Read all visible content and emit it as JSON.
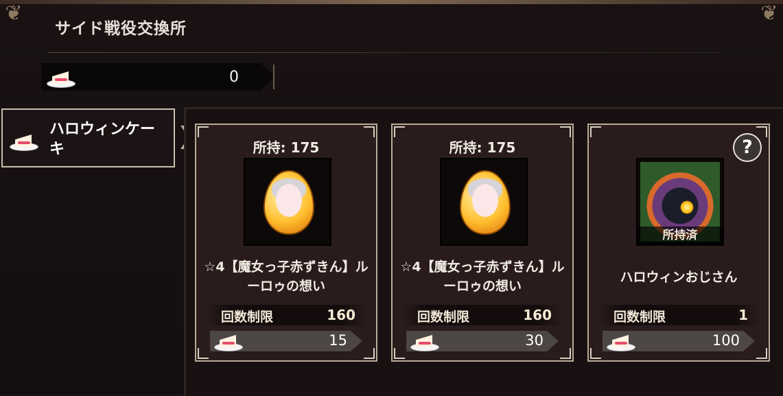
{
  "header": {
    "title": "サイド戦役交換所"
  },
  "currency": {
    "amount": "0",
    "icon": "cake-icon"
  },
  "sidebar": {
    "tab_label": "ハロウィンケーキ"
  },
  "cards": [
    {
      "owned_label": "所持: 175",
      "name": "☆4【魔女っ子赤ずきん】ルーロゥの想い",
      "limit_label": "回数制限",
      "limit_value": "160",
      "price": "15"
    },
    {
      "owned_label": "所持: 175",
      "name": "☆4【魔女っ子赤ずきん】ルーロゥの想い",
      "limit_label": "回数制限",
      "limit_value": "160",
      "price": "30"
    },
    {
      "owned_tag": "所持済",
      "name": "ハロウィンおじさん",
      "limit_label": "回数制限",
      "limit_value": "1",
      "price": "100",
      "help_label": "?"
    }
  ]
}
